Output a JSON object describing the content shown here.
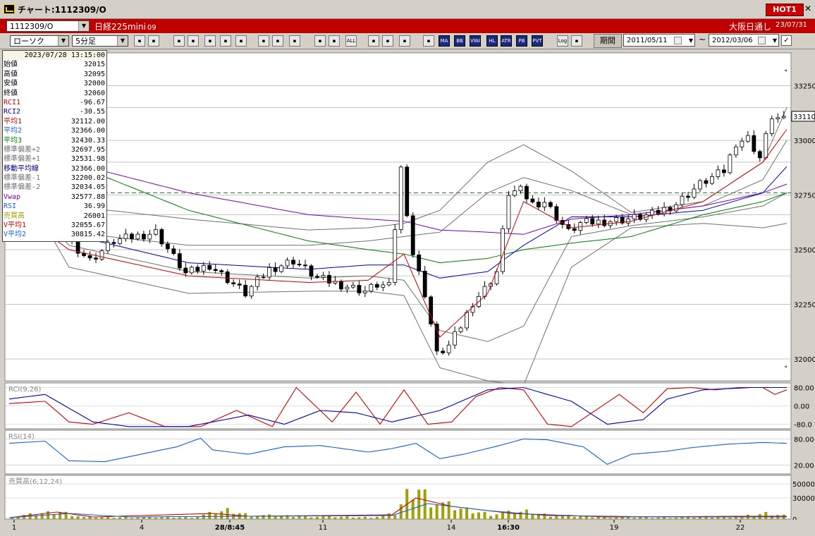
{
  "window": {
    "title": "チャート:1112309/O",
    "hot_label": "HOT1",
    "close_glyph": "✕"
  },
  "header": {
    "symbol": "1112309/O",
    "instrument": "日経225mini",
    "contract": "09",
    "session": "大阪日通し",
    "date": "23/07/31"
  },
  "toolbar": {
    "chart_type": "ローソク",
    "interval": "5分足",
    "buttons": [
      {
        "icon": "zoom-icon"
      },
      {
        "icon": "cursor-bar-icon"
      },
      {
        "icon": "scroll-icon"
      },
      {
        "icon": "calendar-icon"
      },
      {
        "icon": "bar-chart-icon"
      },
      {
        "icon": "cross-icon"
      },
      {
        "icon": "info-icon"
      },
      {
        "icon": "line-draw-icon"
      },
      {
        "icon": "select-arrow-icon"
      },
      {
        "icon": "undo-icon"
      },
      {
        "icon": "candle-add-icon"
      },
      {
        "icon": "candle-remove-icon"
      },
      {
        "icon": "all-icon",
        "text": "ALL"
      },
      {
        "icon": "settings-icon"
      },
      {
        "icon": "edit-icon"
      },
      {
        "icon": "palette-icon"
      },
      {
        "icon": "grid-icon"
      },
      {
        "icon": "ma-icon",
        "text": "MA"
      },
      {
        "icon": "bb-icon",
        "text": "BB"
      },
      {
        "icon": "vwap-icon",
        "text": "VWAP"
      },
      {
        "icon": "hl-icon",
        "text": "HL"
      },
      {
        "icon": "atr-icon",
        "text": "ATR"
      },
      {
        "icon": "pbb-icon",
        "text": "PB"
      },
      {
        "icon": "pvt-icon",
        "text": "PVT"
      },
      {
        "icon": "log-icon",
        "text": "Log"
      },
      {
        "icon": "export-icon"
      }
    ],
    "period_button": "期間",
    "from_date": "2011/05/11",
    "to_date": "2012/03/06",
    "range_sep": "~",
    "check_glyph": "✓"
  },
  "info_panel": {
    "timestamp": "2023/07/28  13:15:00",
    "rows": [
      {
        "label": "始値",
        "value": "32015",
        "color": "#000000"
      },
      {
        "label": "高値",
        "value": "32095",
        "color": "#000000"
      },
      {
        "label": "安値",
        "value": "32000",
        "color": "#000000"
      },
      {
        "label": "終値",
        "value": "32060",
        "color": "#000000"
      },
      {
        "label": "RCI1",
        "value": "-96.67",
        "color": "#d00000"
      },
      {
        "label": "RCI2",
        "value": "-30.55",
        "color": "#0000c0"
      },
      {
        "label": "平均1",
        "value": "32112.00",
        "color": "#d00000"
      },
      {
        "label": "平均2",
        "value": "32366.00",
        "color": "#1060e0"
      },
      {
        "label": "平均3",
        "value": "32430.33",
        "color": "#008000"
      },
      {
        "label": "標準偏差+2",
        "value": "32697.95",
        "color": "#707070"
      },
      {
        "label": "標準偏差+1",
        "value": "32531.98",
        "color": "#707070"
      },
      {
        "label": "移動平均線",
        "value": "32366.00",
        "color": "#000080"
      },
      {
        "label": "標準偏差-1",
        "value": "32200.02",
        "color": "#707070"
      },
      {
        "label": "標準偏差-2",
        "value": "32034.05",
        "color": "#707070"
      },
      {
        "label": "Vwap",
        "value": "32577.88",
        "color": "#8000c0"
      },
      {
        "label": "RSI",
        "value": "36.99",
        "color": "#1060e0"
      },
      {
        "label": "売買高",
        "value": "26001",
        "color": "#a0a000"
      },
      {
        "label": "V平均1",
        "value": "32055.67",
        "color": "#d00000"
      },
      {
        "label": "V平均2",
        "value": "30815.42",
        "color": "#1060e0"
      }
    ]
  },
  "chart_data": {
    "type": "candlestick",
    "price_axis": {
      "ticks": [
        "33250",
        "33000",
        "32750",
        "32500",
        "32250",
        "32000"
      ],
      "min": 31900,
      "max": 33400
    },
    "last_price": "33110",
    "reference_line": 32760,
    "x_ticks": [
      "1",
      "4",
      "28/8:45",
      "11",
      "14",
      "16:30",
      "19",
      "22"
    ],
    "price_path": [
      [
        0,
        32720
      ],
      [
        8,
        32610
      ],
      [
        14,
        32450
      ],
      [
        18,
        32540
      ],
      [
        25,
        32580
      ],
      [
        30,
        32390
      ],
      [
        34,
        32430
      ],
      [
        40,
        32300
      ],
      [
        44,
        32410
      ],
      [
        48,
        32450
      ],
      [
        52,
        32370
      ],
      [
        56,
        32340
      ],
      [
        60,
        32310
      ],
      [
        62,
        32340
      ],
      [
        64,
        32330
      ],
      [
        66,
        32870
      ],
      [
        68,
        32480
      ],
      [
        70,
        32300
      ],
      [
        72,
        32020
      ],
      [
        74,
        32060
      ],
      [
        76,
        32150
      ],
      [
        78,
        32260
      ],
      [
        80,
        32320
      ],
      [
        82,
        32400
      ],
      [
        84,
        32760
      ],
      [
        86,
        32770
      ],
      [
        88,
        32710
      ],
      [
        90,
        32720
      ],
      [
        94,
        32580
      ],
      [
        96,
        32620
      ],
      [
        100,
        32630
      ],
      [
        104,
        32640
      ],
      [
        108,
        32660
      ],
      [
        112,
        32710
      ],
      [
        116,
        32800
      ],
      [
        120,
        32860
      ],
      [
        122,
        32990
      ],
      [
        124,
        33010
      ],
      [
        126,
        32920
      ],
      [
        128,
        33110
      ],
      [
        130,
        33090
      ]
    ],
    "n_candles": 130,
    "overlays": {
      "bb_upper2": [
        [
          0,
          33100
        ],
        [
          10,
          32700
        ],
        [
          30,
          32640
        ],
        [
          50,
          32590
        ],
        [
          60,
          32600
        ],
        [
          66,
          32620
        ],
        [
          72,
          32680
        ],
        [
          80,
          32900
        ],
        [
          86,
          32980
        ],
        [
          94,
          32860
        ],
        [
          104,
          32670
        ],
        [
          116,
          32720
        ],
        [
          126,
          32900
        ],
        [
          130,
          33150
        ]
      ],
      "bb_lower2": [
        [
          0,
          32900
        ],
        [
          10,
          32420
        ],
        [
          30,
          32300
        ],
        [
          50,
          32310
        ],
        [
          60,
          32310
        ],
        [
          66,
          32290
        ],
        [
          72,
          31960
        ],
        [
          80,
          31900
        ],
        [
          86,
          31880
        ],
        [
          94,
          32420
        ],
        [
          104,
          32600
        ],
        [
          116,
          32620
        ],
        [
          126,
          32600
        ],
        [
          130,
          32620
        ]
      ],
      "bb_upper1": [
        [
          0,
          32980
        ],
        [
          10,
          32580
        ],
        [
          30,
          32520
        ],
        [
          50,
          32520
        ],
        [
          60,
          32540
        ],
        [
          66,
          32560
        ],
        [
          72,
          32580
        ],
        [
          80,
          32760
        ],
        [
          86,
          32830
        ],
        [
          94,
          32770
        ],
        [
          104,
          32660
        ],
        [
          116,
          32700
        ],
        [
          126,
          32820
        ],
        [
          130,
          33000
        ]
      ],
      "bb_lower1": [
        [
          0,
          32820
        ],
        [
          10,
          32520
        ],
        [
          30,
          32400
        ],
        [
          50,
          32370
        ],
        [
          60,
          32380
        ],
        [
          66,
          32360
        ],
        [
          72,
          32130
        ],
        [
          80,
          32080
        ],
        [
          86,
          32150
        ],
        [
          94,
          32560
        ],
        [
          104,
          32610
        ],
        [
          116,
          32650
        ],
        [
          126,
          32700
        ],
        [
          130,
          32760
        ]
      ],
      "ma_mid": [
        [
          0,
          32880
        ],
        [
          10,
          32570
        ],
        [
          30,
          32440
        ],
        [
          50,
          32410
        ],
        [
          60,
          32430
        ],
        [
          66,
          32430
        ],
        [
          72,
          32370
        ],
        [
          80,
          32400
        ],
        [
          86,
          32520
        ],
        [
          94,
          32650
        ],
        [
          104,
          32650
        ],
        [
          116,
          32680
        ],
        [
          126,
          32760
        ],
        [
          130,
          32880
        ]
      ],
      "ma_short": [
        [
          0,
          32700
        ],
        [
          10,
          32500
        ],
        [
          30,
          32380
        ],
        [
          50,
          32350
        ],
        [
          60,
          32360
        ],
        [
          66,
          32480
        ],
        [
          72,
          32100
        ],
        [
          80,
          32300
        ],
        [
          86,
          32720
        ],
        [
          94,
          32600
        ],
        [
          104,
          32630
        ],
        [
          116,
          32720
        ],
        [
          126,
          32900
        ],
        [
          130,
          33050
        ]
      ],
      "ma_long": [
        [
          0,
          33100
        ],
        [
          10,
          32900
        ],
        [
          30,
          32680
        ],
        [
          50,
          32540
        ],
        [
          60,
          32500
        ],
        [
          66,
          32480
        ],
        [
          72,
          32440
        ],
        [
          80,
          32460
        ],
        [
          86,
          32500
        ],
        [
          94,
          32530
        ],
        [
          104,
          32560
        ],
        [
          116,
          32660
        ],
        [
          126,
          32720
        ],
        [
          130,
          32760
        ]
      ],
      "vwap": [
        [
          0,
          32980
        ],
        [
          10,
          32900
        ],
        [
          30,
          32760
        ],
        [
          50,
          32660
        ],
        [
          60,
          32640
        ],
        [
          66,
          32630
        ],
        [
          72,
          32590
        ],
        [
          80,
          32580
        ],
        [
          86,
          32570
        ],
        [
          94,
          32640
        ],
        [
          104,
          32660
        ],
        [
          116,
          32700
        ],
        [
          126,
          32760
        ],
        [
          130,
          32800
        ]
      ]
    },
    "rci": {
      "label": "RCI(9,26)",
      "ticks": [
        "80.00",
        "0.00",
        "-80.0"
      ]
    },
    "rsi": {
      "label": "RSI(14)",
      "ticks": [
        "80.00",
        "20.00"
      ]
    },
    "volume": {
      "label": "売買高(6,12,24)",
      "ticks": [
        "50000",
        "30000",
        "0"
      ]
    }
  },
  "colors": {
    "bg": "#ffffff",
    "panel_grid": "#808080",
    "up_candle": "#ffffff",
    "down_candle": "#000000",
    "ma_short": "#d00000",
    "ma_mid": "#0000c0",
    "ma_long": "#008000",
    "vwap": "#8000c0",
    "bb": "#707070",
    "rci1": "#d00000",
    "rci2": "#0000c0",
    "rsi": "#1060e0",
    "volume": "#a0a000"
  }
}
